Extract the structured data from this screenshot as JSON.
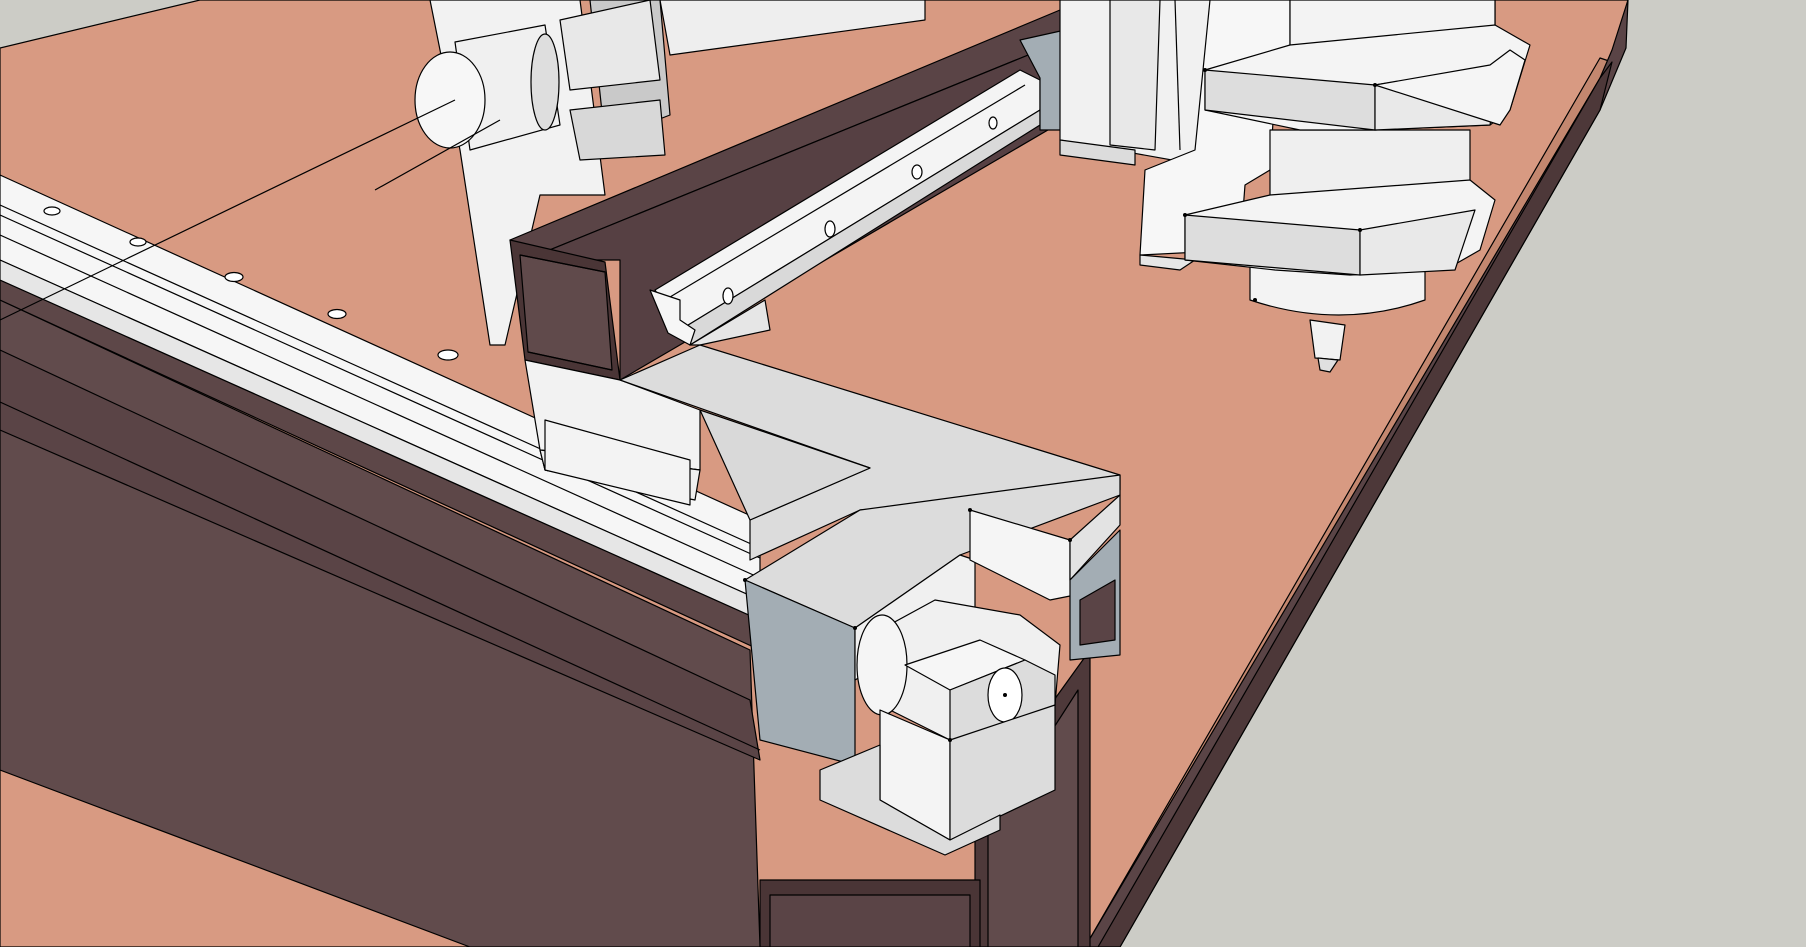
{
  "scene": {
    "description": "",
    "colors": {
      "background": "#ccccc6",
      "table_top": "#d89a82",
      "table_top_side": "#c3876f",
      "frame_dark": "#5a4446",
      "frame_front": "#614b4c",
      "frame_shadow": "#4a3536",
      "part_light": "#f2f2f2",
      "part_mid": "#dcdcdc",
      "part_shade": "#bdbdbd",
      "part_blue": "#a3adb4",
      "rail_white": "#f6f6f6",
      "edge": "#000000"
    }
  }
}
